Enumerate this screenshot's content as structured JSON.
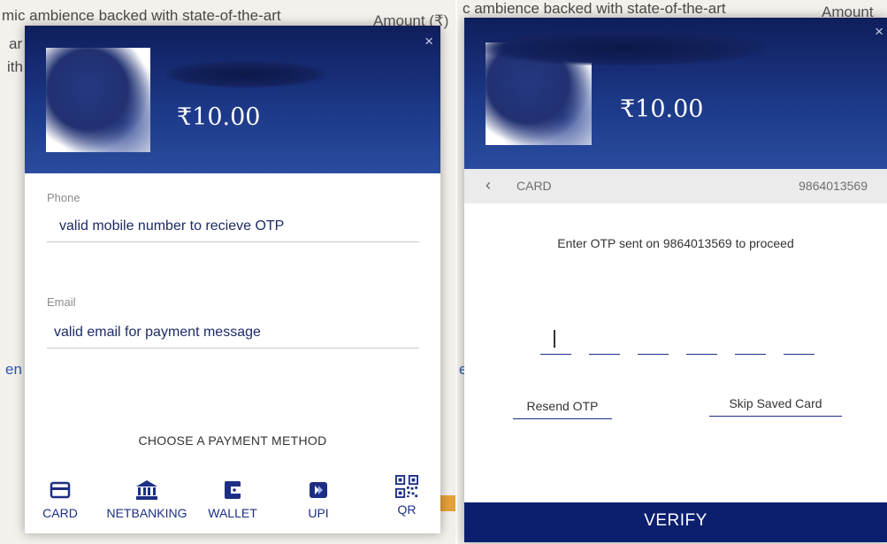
{
  "background": {
    "left_line1": "mic ambience backed with state-of-the-art",
    "left_line2": "ar",
    "left_line3": "ith",
    "left_amount": "Amount (₹)",
    "left_link": "en",
    "right_line1": "c ambience backed with state-of-the-art",
    "right_amount": "Amount",
    "right_link": "en"
  },
  "left_modal": {
    "amount": "₹10.00",
    "close_icon": "×",
    "phone": {
      "label": "Phone",
      "value": "valid mobile number to recieve OTP"
    },
    "email": {
      "label": "Email",
      "value": "valid email for payment message"
    },
    "choose_label": "CHOOSE A PAYMENT METHOD",
    "methods": [
      {
        "label": "CARD",
        "icon": "card-icon"
      },
      {
        "label": "NETBANKING",
        "icon": "bank-icon"
      },
      {
        "label": "WALLET",
        "icon": "wallet-icon"
      },
      {
        "label": "UPI",
        "icon": "upi-icon"
      },
      {
        "label": "QR",
        "icon": "qr-icon"
      }
    ]
  },
  "right_modal": {
    "amount": "₹10.00",
    "close_icon": "×",
    "back_icon": "‹",
    "method_name": "CARD",
    "phone": "9864013569",
    "otp_message": "Enter OTP sent on 9864013569 to proceed",
    "resend_label": "Resend OTP",
    "skip_label": "Skip Saved Card",
    "verify_label": "VERIFY"
  },
  "colors": {
    "accent": "#1d2f84",
    "header_top": "#0f1e5c",
    "verify_bg": "#0c1f6f"
  }
}
